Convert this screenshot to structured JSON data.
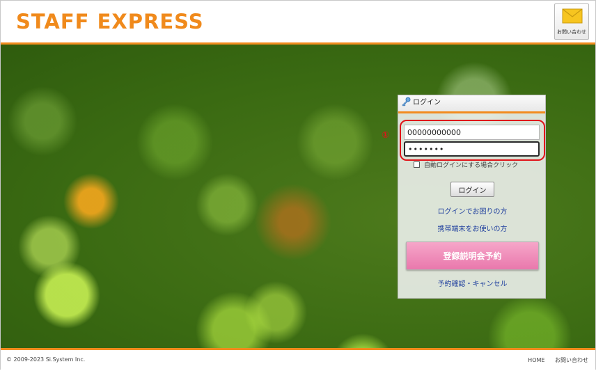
{
  "header": {
    "logo_text": "STAFF EXPRESS",
    "contact_button_label": "お問い合わせ",
    "contact_icon": "mail-icon"
  },
  "login": {
    "title": "ログイン",
    "title_icon": "key-icon",
    "user_id_value": "00000000000",
    "password_value": "•••••••",
    "auto_login_label": "自動ログインにする場合クリック",
    "auto_login_checked": false,
    "login_button": "ログイン",
    "trouble_link": "ログインでお困りの方",
    "mobile_link": "携帯端末をお使いの方",
    "reserve_button": "登録説明会予約",
    "cancel_link": "予約確認・キャンセル"
  },
  "annotation": {
    "marker": "①",
    "color": "#e0141a"
  },
  "footer": {
    "copyright": "© 2009-2023 Si.System Inc.",
    "links": [
      "HOME",
      "お問い合わせ"
    ]
  },
  "colors": {
    "accent": "#f28c1e",
    "reserve_button": "#ee8fba",
    "link": "#1f3f9e"
  }
}
